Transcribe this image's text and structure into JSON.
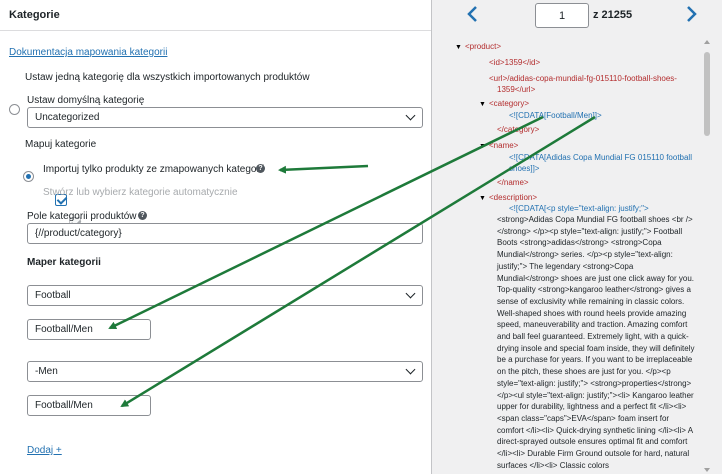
{
  "panel": {
    "title": "Kategorie",
    "docs_link": "Dokumentacja mapowania kategorii",
    "option_single": "Ustaw jedną kategorię dla wszystkich importowanych produktów",
    "default_category_label": "Ustaw domyślną kategorię",
    "default_category_value": "Uncategorized",
    "option_map": "Mapuj kategorie",
    "import_only_mapped": "Importuj tylko produkty ze zmapowanych kategorii",
    "auto_create": "Stwórz lub wybierz kategorie automatycznie",
    "product_category_field_label": "Pole kategorii produktów",
    "product_category_field_value": "{//product/category}",
    "mapper_heading": "Maper kategorii",
    "mappings": [
      {
        "select": "Football",
        "input": "Football/Men"
      },
      {
        "select": "-Men",
        "input": "Football/Men"
      }
    ],
    "add_link": "Dodaj +",
    "help_symbol": "?"
  },
  "pager": {
    "current": "1",
    "total_text": "z 21255"
  },
  "xml": {
    "lines": [
      "<product>",
      "<id>1359</id>",
      "<url>/adidas-copa-mundial-fg-015110-football-shoes-",
      "1359</url>",
      "<category>",
      "<![CDATA[Football/Men]]>",
      "</category>",
      "<name>",
      "<![CDATA[Adidas Copa Mundial FG 015110 football",
      "shoes]]>",
      "</name>",
      "<description>",
      "<![CDATA[<p style=\"text-align: justify;\">"
    ],
    "description": "<strong>Adidas Copa Mundial FG football shoes <br /></strong> </p><p style=\"text-align: justify;\"> Football Boots <strong>adidas</strong> <strong>Copa Mundial</strong> series. </p><p style=\"text-align: justify;\"> The legendary <strong>Copa Mundial</strong> shoes are just one click away for you. Top-quality <strong>kangaroo leather</strong> gives a sense of exclusivity while remaining in classic colors. Well-shaped shoes with round heels provide amazing speed, maneuverability and traction. Amazing comfort and ball feel guaranteed. Extremely light, with a quick-drying insole and special foam inside, they will definitely be a purchase for years. If you want to be irreplaceable on the pitch, these shoes are just for you. </p><p style=\"text-align: justify;\"> <strong>properties</strong> </p><ul style=\"text-align: justify;\"><li> Kangaroo leather upper for durability, lightness and a perfect fit </li><li> <span class=\"caps\">EVA</span> foam insert for comfort </li><li> Quick-drying synthetic lining </li><li> A direct-sprayed outsole ensures optimal fit and comfort </li><li> Durable Firm Ground outsole for hard, natural surfaces </li><li> Classic colors"
  },
  "colors": {
    "accent": "#2271b1",
    "arrow": "#1e7a3a",
    "delete": "#d63638",
    "xml_tag": "#b32d2e"
  },
  "icons": [
    "help-icon",
    "trash-icon",
    "chevron-left-icon",
    "chevron-right-icon",
    "chevron-down-icon",
    "triangle-down-icon"
  ]
}
